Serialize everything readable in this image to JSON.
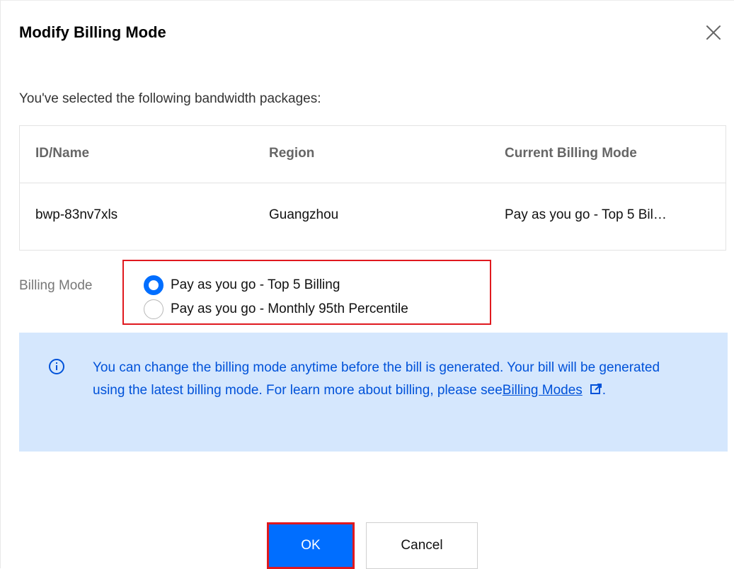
{
  "dialog": {
    "title": "Modify Billing Mode",
    "close_icon": "close-icon"
  },
  "intro": "You've selected the following bandwidth packages:",
  "table": {
    "headers": [
      "ID/Name",
      "Region",
      "Current Billing Mode"
    ],
    "rows": [
      [
        "bwp-83nv7xls",
        "Guangzhou",
        "Pay as you go - Top 5 Bil…"
      ]
    ]
  },
  "billing": {
    "label": "Billing Mode",
    "options": [
      {
        "label": "Pay as you go - Top 5 Billing",
        "checked": true
      },
      {
        "label": "Pay as you go - Monthly 95th Percentile",
        "checked": false
      }
    ]
  },
  "info": {
    "icon": "info-icon",
    "text": "You can change the billing mode anytime before the bill is generated. Your bill will be generated using the latest billing mode. For learn more about billing, please see",
    "link_text": "Billing Modes",
    "link_icon": "external-link-icon",
    "suffix": "."
  },
  "buttons": {
    "ok": "OK",
    "cancel": "Cancel"
  },
  "colors": {
    "accent": "#006eff",
    "highlight_border": "#e0191f",
    "info_bg": "#d5e7fd",
    "info_text": "#0052d9"
  }
}
